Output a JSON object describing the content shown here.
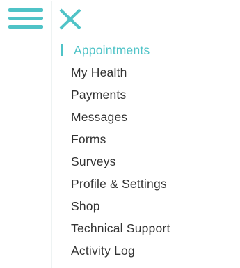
{
  "header": {
    "menu_icon": "hamburger-menu-icon",
    "close_icon": "close-icon"
  },
  "colors": {
    "accent": "#4fc3c7",
    "text": "#333333"
  },
  "nav": {
    "items": [
      {
        "label": "Appointments",
        "active": true
      },
      {
        "label": "My Health",
        "active": false
      },
      {
        "label": "Payments",
        "active": false
      },
      {
        "label": "Messages",
        "active": false
      },
      {
        "label": "Forms",
        "active": false
      },
      {
        "label": "Surveys",
        "active": false
      },
      {
        "label": "Profile & Settings",
        "active": false
      },
      {
        "label": "Shop",
        "active": false
      },
      {
        "label": "Technical Support",
        "active": false
      },
      {
        "label": "Activity Log",
        "active": false
      }
    ]
  }
}
